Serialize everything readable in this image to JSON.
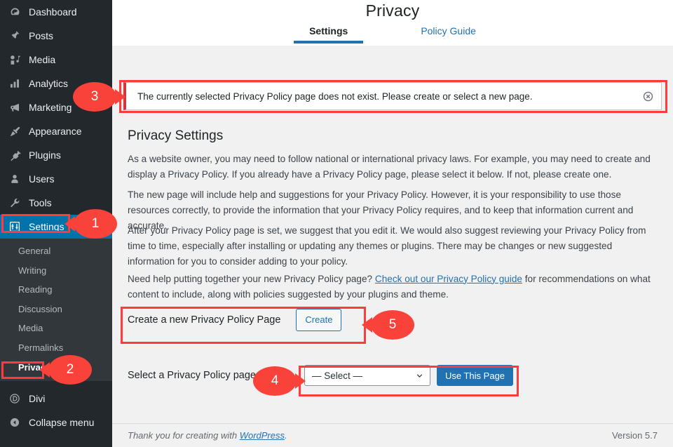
{
  "sidebar": {
    "items": [
      {
        "label": "Dashboard",
        "icon": "dashboard-icon"
      },
      {
        "label": "Posts",
        "icon": "pin-icon"
      },
      {
        "label": "Media",
        "icon": "media-icon"
      },
      {
        "label": "Analytics",
        "icon": "chart-bar-icon"
      },
      {
        "label": "Marketing",
        "icon": "megaphone-icon"
      },
      {
        "label": "Appearance",
        "icon": "paintbrush-icon"
      },
      {
        "label": "Plugins",
        "icon": "plug-icon"
      },
      {
        "label": "Users",
        "icon": "user-icon"
      },
      {
        "label": "Tools",
        "icon": "wrench-icon"
      },
      {
        "label": "Settings",
        "icon": "settings-sliders-icon",
        "current": true
      }
    ],
    "submenu": [
      {
        "label": "General"
      },
      {
        "label": "Writing"
      },
      {
        "label": "Reading"
      },
      {
        "label": "Discussion"
      },
      {
        "label": "Media"
      },
      {
        "label": "Permalinks"
      },
      {
        "label": "Privacy",
        "current": true
      }
    ],
    "footer_items": [
      {
        "label": "Divi",
        "icon": "divi-icon"
      },
      {
        "label": "Collapse menu",
        "icon": "collapse-arrow-icon"
      }
    ]
  },
  "header": {
    "title": "Privacy",
    "tabs": [
      {
        "label": "Settings",
        "active": true
      },
      {
        "label": "Policy Guide",
        "active": false
      }
    ]
  },
  "notice": {
    "text": "The currently selected Privacy Policy page does not exist. Please create or select a new page.",
    "dismiss_label": "Dismiss this notice",
    "accent_color": "#d63638"
  },
  "main": {
    "section_title": "Privacy Settings",
    "paragraph_1": "As a website owner, you may need to follow national or international privacy laws. For example, you may need to create and display a Privacy Policy. If you already have a Privacy Policy page, please select it below. If not, please create one.",
    "paragraph_2": "The new page will include help and suggestions for your Privacy Policy. However, it is your responsibility to use those resources correctly, to provide the information that your Privacy Policy requires, and to keep that information current and accurate.",
    "paragraph_3": "After your Privacy Policy page is set, we suggest that you edit it. We would also suggest reviewing your Privacy Policy from time to time, especially after installing or updating any themes or plugins. There may be changes or new suggested information for you to consider adding to your policy.",
    "paragraph_4_before": "Need help putting together your new Privacy Policy page? ",
    "paragraph_4_link": "Check out our Privacy Policy guide",
    "paragraph_4_after": " for recommendations on what content to include, along with policies suggested by your plugins and theme.",
    "create_label": "Create a new Privacy Policy Page",
    "create_button": "Create",
    "select_label": "Select a Privacy Policy page",
    "select_value": "— Select —",
    "use_button": "Use This Page"
  },
  "footer": {
    "thanks_before": "Thank you for creating with ",
    "thanks_link": "WordPress",
    "thanks_after": ".",
    "version": "Version 5.7"
  },
  "annotations": {
    "callouts": [
      {
        "number": "1",
        "target": "settings-menu-item"
      },
      {
        "number": "2",
        "target": "privacy-submenu-item"
      },
      {
        "number": "3",
        "target": "notice"
      },
      {
        "number": "4",
        "target": "select-privacy-page-control"
      },
      {
        "number": "5",
        "target": "create-page-row"
      }
    ],
    "box_color": "#ff3b3b"
  }
}
